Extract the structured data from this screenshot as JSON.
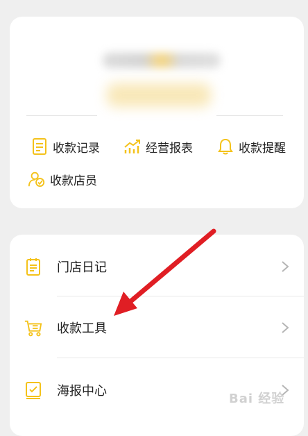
{
  "quick_menu": [
    {
      "label": "收款记录",
      "icon": "document-icon"
    },
    {
      "label": "经营报表",
      "icon": "trend-chart-icon"
    },
    {
      "label": "收款提醒",
      "icon": "bell-icon"
    },
    {
      "label": "收款店员",
      "icon": "staff-icon"
    }
  ],
  "list": [
    {
      "label": "门店日记",
      "icon": "notepad-icon"
    },
    {
      "label": "收款工具",
      "icon": "cart-icon"
    },
    {
      "label": "海报中心",
      "icon": "poster-icon"
    }
  ],
  "colors": {
    "accent": "#f4c21a",
    "arrow": "#e01e24",
    "text": "#222222",
    "chevron": "#b5b5b5"
  },
  "watermark": "Bai 经验"
}
